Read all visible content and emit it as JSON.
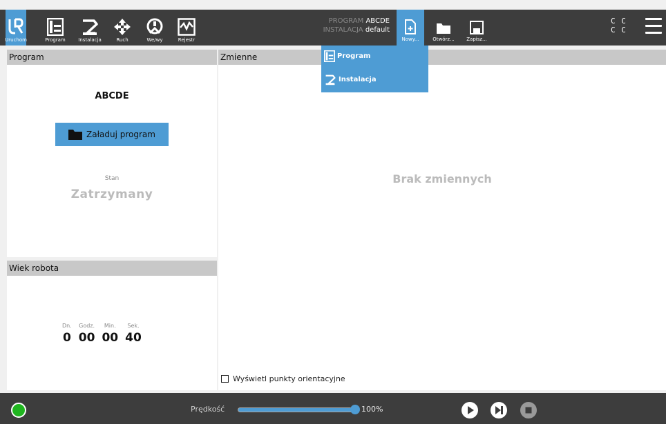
{
  "topbar": {
    "nav": [
      {
        "label": "Uruchom",
        "icon": "ur-logo-icon"
      },
      {
        "label": "Program",
        "icon": "program-tree-icon"
      },
      {
        "label": "Instalacja",
        "icon": "robot-arm-icon"
      },
      {
        "label": "Ruch",
        "icon": "move-arrows-icon"
      },
      {
        "label": "We/wy",
        "icon": "io-icon"
      },
      {
        "label": "Rejestr",
        "icon": "log-icon"
      }
    ],
    "program_key": "PROGRAM",
    "program_value": "ABCDE",
    "install_key": "INSTALACJA",
    "install_value": "default",
    "file": {
      "new_label": "Nowy...",
      "open_label": "Otwórz...",
      "save_label": "Zapisz..."
    },
    "cc_top": "C C",
    "cc_bottom": "C C"
  },
  "new_menu": {
    "items": [
      {
        "label": "Program",
        "icon": "program-tree-icon"
      },
      {
        "label": "Instalacja",
        "icon": "robot-arm-icon"
      }
    ]
  },
  "program_panel": {
    "header": "Program",
    "name": "ABCDE",
    "load_button": "Załaduj program",
    "state_label": "Stan",
    "state_value": "Zatrzymany"
  },
  "robot_age": {
    "header": "Wiek robota",
    "units": [
      "Dn.",
      "Godz.",
      "Min.",
      "Sek."
    ],
    "values": [
      "0",
      "00",
      "00",
      "40"
    ]
  },
  "variables": {
    "header": "Zmienne",
    "empty_text": "Brak zmiennych",
    "show_waypoints": "Wyświetl punkty orientacyjne"
  },
  "bottombar": {
    "speed_label": "Prędkość",
    "speed_value": "100%",
    "speed_fraction": 1.0
  },
  "colors": {
    "accent": "#4e9cd4",
    "bar": "#3d3d3d",
    "power_on": "#1fb51f"
  }
}
